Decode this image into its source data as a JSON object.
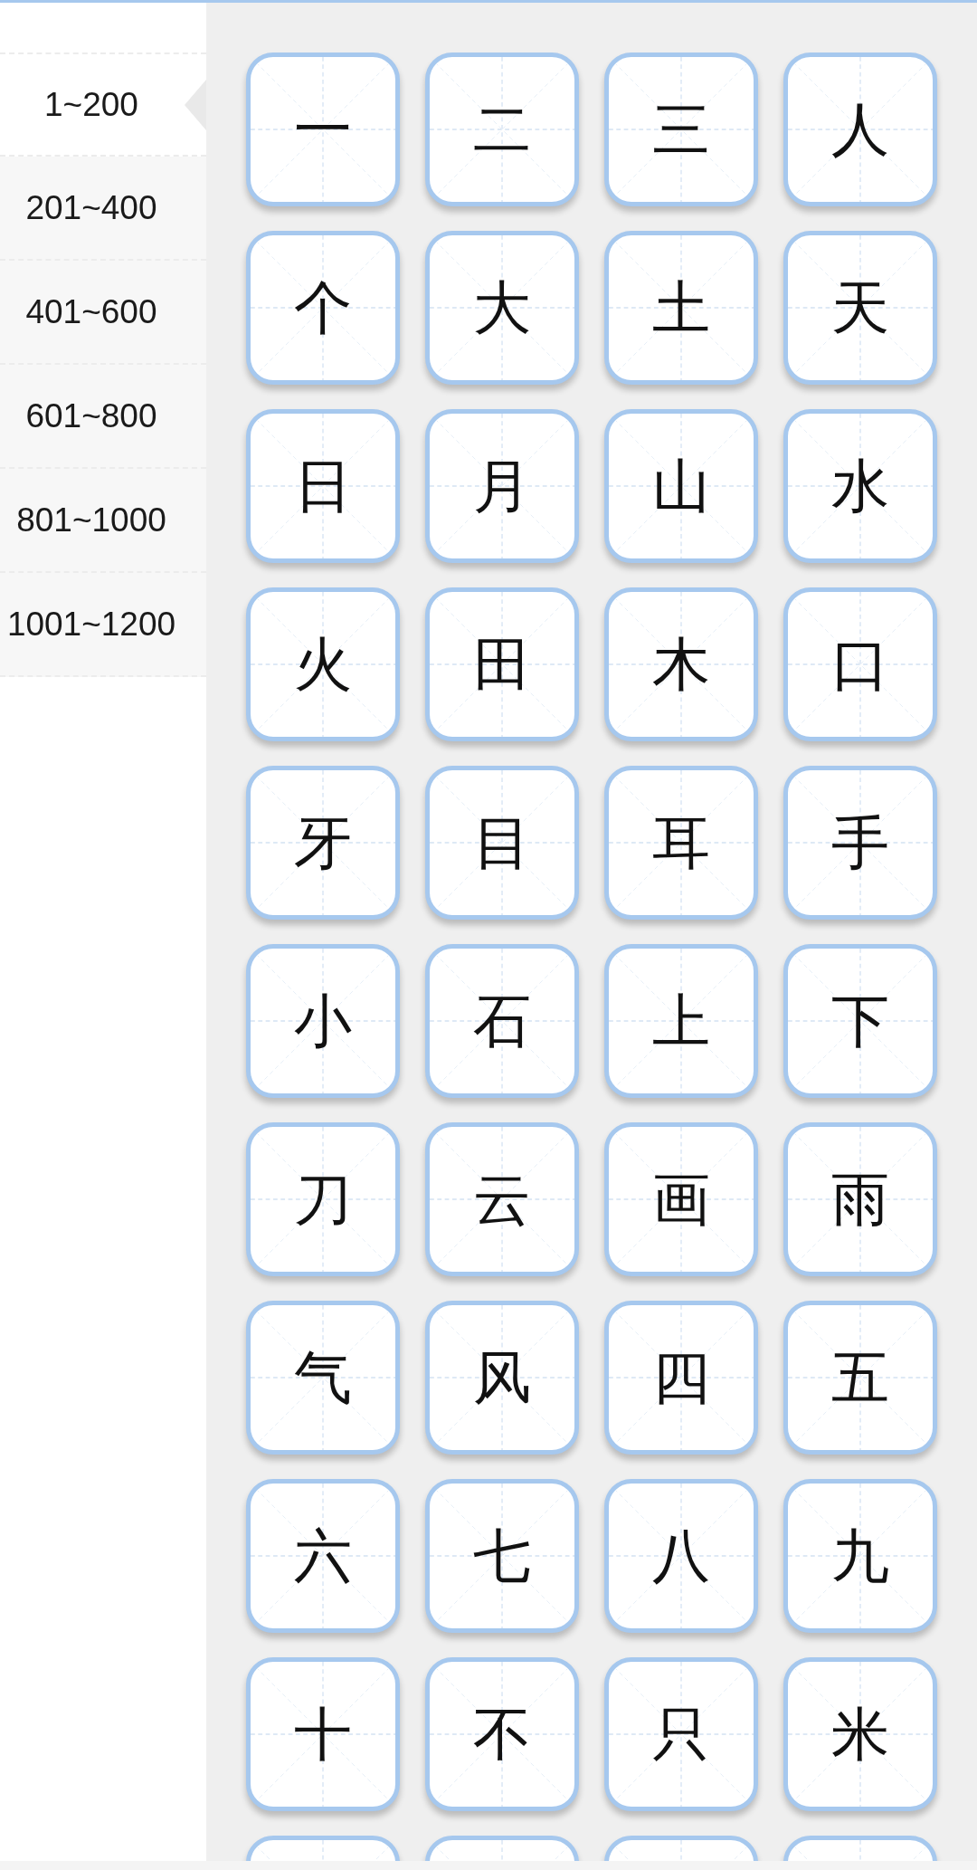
{
  "sidebar": {
    "items": [
      {
        "label": "1~200",
        "selected": true
      },
      {
        "label": "201~400",
        "selected": false
      },
      {
        "label": "401~600",
        "selected": false
      },
      {
        "label": "601~800",
        "selected": false
      },
      {
        "label": "801~1000",
        "selected": false
      },
      {
        "label": "1001~1200",
        "selected": false
      }
    ]
  },
  "characters": [
    {
      "kind": "character",
      "char": "一"
    },
    {
      "kind": "character",
      "char": "二"
    },
    {
      "kind": "character",
      "char": "三"
    },
    {
      "kind": "character",
      "char": "人"
    },
    {
      "kind": "character",
      "char": "个"
    },
    {
      "kind": "character",
      "char": "大"
    },
    {
      "kind": "character",
      "char": "土"
    },
    {
      "kind": "character",
      "char": "天"
    },
    {
      "kind": "character",
      "char": "日"
    },
    {
      "kind": "character",
      "char": "月"
    },
    {
      "kind": "character",
      "char": "山"
    },
    {
      "kind": "character",
      "char": "水"
    },
    {
      "kind": "character",
      "char": "火"
    },
    {
      "kind": "character",
      "char": "田"
    },
    {
      "kind": "character",
      "char": "木"
    },
    {
      "kind": "character",
      "char": "口"
    },
    {
      "kind": "character",
      "char": "牙"
    },
    {
      "kind": "character",
      "char": "目"
    },
    {
      "kind": "character",
      "char": "耳"
    },
    {
      "kind": "character",
      "char": "手"
    },
    {
      "kind": "character",
      "char": "小"
    },
    {
      "kind": "character",
      "char": "石"
    },
    {
      "kind": "character",
      "char": "上"
    },
    {
      "kind": "character",
      "char": "下"
    },
    {
      "kind": "character",
      "char": "刀"
    },
    {
      "kind": "character",
      "char": "云"
    },
    {
      "kind": "character",
      "char": "画"
    },
    {
      "kind": "character",
      "char": "雨"
    },
    {
      "kind": "character",
      "char": "气"
    },
    {
      "kind": "character",
      "char": "风"
    },
    {
      "kind": "character",
      "char": "四"
    },
    {
      "kind": "character",
      "char": "五"
    },
    {
      "kind": "character",
      "char": "六"
    },
    {
      "kind": "character",
      "char": "七"
    },
    {
      "kind": "character",
      "char": "八"
    },
    {
      "kind": "character",
      "char": "九"
    },
    {
      "kind": "character",
      "char": "十"
    },
    {
      "kind": "character",
      "char": "不"
    },
    {
      "kind": "character",
      "char": "只"
    },
    {
      "kind": "character",
      "char": "米"
    },
    {
      "kind": "blank"
    },
    {
      "kind": "blank"
    },
    {
      "kind": "blank"
    },
    {
      "kind": "blank"
    }
  ]
}
